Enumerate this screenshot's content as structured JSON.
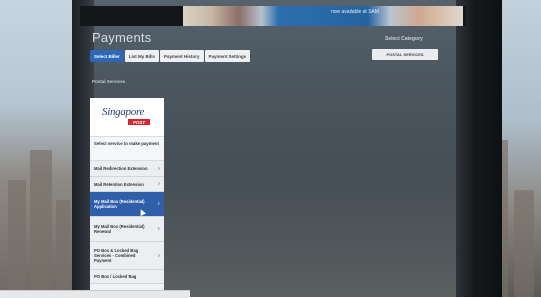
{
  "banner": {
    "line1": "",
    "line2": "now available at SAM"
  },
  "page": {
    "title": "Payments",
    "select_category_label": "Select Category",
    "category_value": "POSTAL SERVICES",
    "section_label": "Postal Services"
  },
  "tabs": [
    {
      "label": "Select Biller",
      "active": true
    },
    {
      "label": "List My Bills",
      "active": false
    },
    {
      "label": "Payment History",
      "active": false
    },
    {
      "label": "Payment Settings",
      "active": false
    }
  ],
  "card": {
    "logo_word": "Singapore",
    "logo_post": "POST",
    "prompt": "Select service to make payment",
    "services": [
      {
        "label": "Mail Redirection Extension"
      },
      {
        "label": "Mail Retention Extension"
      },
      {
        "label": "My Mail Box (Residential) Application",
        "selected": true
      },
      {
        "label": "My Mail Box (Residential) Renewal"
      },
      {
        "label": "PO Box & Locked Bag Services - Combined Payment"
      },
      {
        "label": "PO Box / Locked Bag"
      }
    ]
  },
  "colors": {
    "tab_active": "#2e66b8",
    "selected_row": "#2f5fa8",
    "logo_red": "#d8262f",
    "logo_navy": "#253a6e"
  }
}
